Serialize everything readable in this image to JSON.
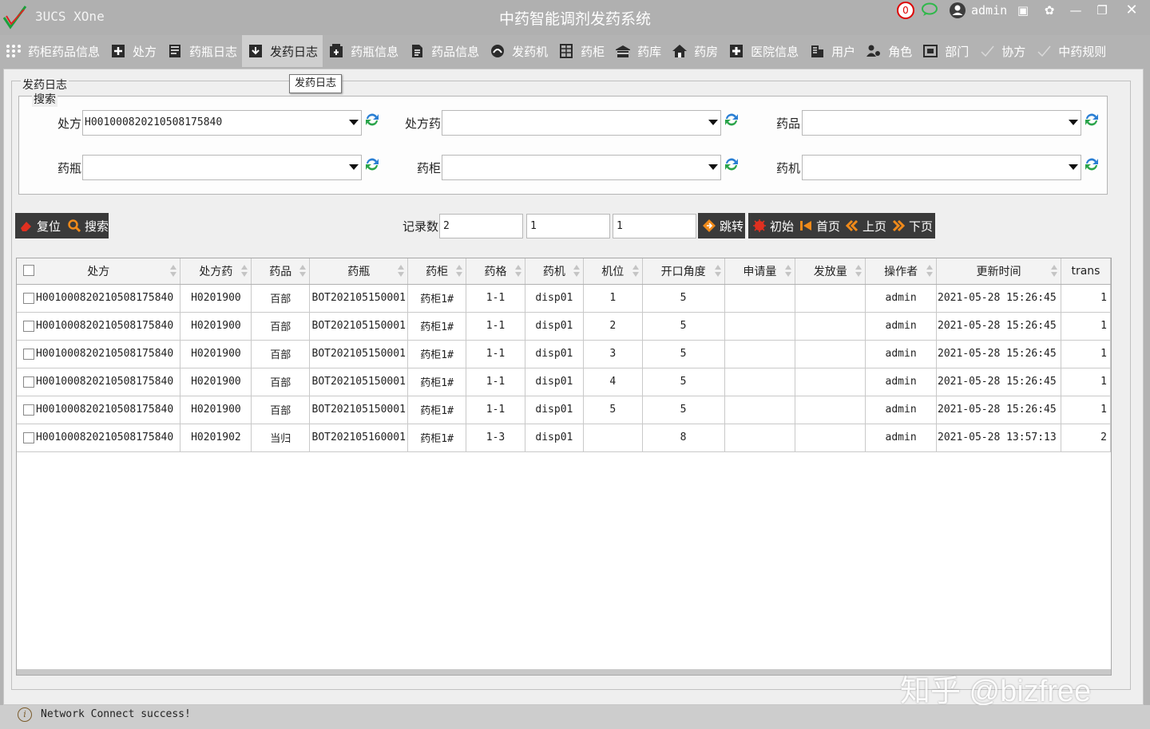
{
  "app": {
    "name": "3UCS XOne",
    "window_title": "中药智能调剂发药系统",
    "notification_count": "0",
    "user_name": "admin"
  },
  "menu": [
    {
      "label": "药柜药品信息",
      "icon": "grid-dots-icon"
    },
    {
      "label": "处方",
      "icon": "prescription-add-icon"
    },
    {
      "label": "药瓶日志",
      "icon": "log-icon"
    },
    {
      "label": "发药日志",
      "icon": "dispense-log-icon",
      "active": true
    },
    {
      "label": "药瓶信息",
      "icon": "bottle-info-icon"
    },
    {
      "label": "药品信息",
      "icon": "drug-doc-icon"
    },
    {
      "label": "发药机",
      "icon": "machine-icon"
    },
    {
      "label": "药柜",
      "icon": "cabinet-icon"
    },
    {
      "label": "药库",
      "icon": "warehouse-icon"
    },
    {
      "label": "药房",
      "icon": "home-icon"
    },
    {
      "label": "医院信息",
      "icon": "hospital-icon"
    },
    {
      "label": "用户",
      "icon": "building-icon"
    },
    {
      "label": "角色",
      "icon": "roles-icon"
    },
    {
      "label": "部门",
      "icon": "department-icon"
    },
    {
      "label": "协方",
      "icon": "check-icon"
    },
    {
      "label": "中药规则",
      "icon": "check-icon"
    }
  ],
  "panel": {
    "title": "发药日志",
    "tooltip": "发药日志",
    "search_title": "搜索"
  },
  "search": {
    "prescription": {
      "label": "处方",
      "value": "H0010008202105081758​40"
    },
    "prescription_drug": {
      "label": "处方药",
      "value": ""
    },
    "drug": {
      "label": "药品",
      "value": ""
    },
    "bottle": {
      "label": "药瓶",
      "value": ""
    },
    "cabinet": {
      "label": "药柜",
      "value": ""
    },
    "machine": {
      "label": "药机",
      "value": ""
    }
  },
  "toolbar": {
    "reset": "复位",
    "search": "搜索",
    "record_count_label": "记录数",
    "record_count": "2",
    "page_current": "1",
    "page_total": "1",
    "jump": "跳转",
    "init": "初始",
    "first": "首页",
    "prev": "上页",
    "next": "下页"
  },
  "table": {
    "columns": [
      "处方",
      "处方药",
      "药品",
      "药瓶",
      "药柜",
      "药格",
      "药机",
      "机位",
      "开口角度",
      "申请量",
      "发放量",
      "操作者",
      "更新时间",
      "trans"
    ],
    "rows": [
      [
        "H00100082021050817584​0",
        "H0201900",
        "百部",
        "BOT202105150001",
        "药柜1#",
        "1-1",
        "disp01",
        "1",
        "5",
        "",
        "",
        "admin",
        "2021-05-28 15:26:45",
        "1"
      ],
      [
        "H00100082021050817584​0",
        "H0201900",
        "百部",
        "BOT202105150001",
        "药柜1#",
        "1-1",
        "disp01",
        "2",
        "5",
        "",
        "",
        "admin",
        "2021-05-28 15:26:45",
        "1"
      ],
      [
        "H00100082021050817584​0",
        "H0201900",
        "百部",
        "BOT202105150001",
        "药柜1#",
        "1-1",
        "disp01",
        "3",
        "5",
        "",
        "",
        "admin",
        "2021-05-28 15:26:45",
        "1"
      ],
      [
        "H00100082021050817584​0",
        "H0201900",
        "百部",
        "BOT202105150001",
        "药柜1#",
        "1-1",
        "disp01",
        "4",
        "5",
        "",
        "",
        "admin",
        "2021-05-28 15:26:45",
        "1"
      ],
      [
        "H00100082021050817584​0",
        "H0201900",
        "百部",
        "BOT202105150001",
        "药柜1#",
        "1-1",
        "disp01",
        "5",
        "5",
        "",
        "",
        "admin",
        "2021-05-28 15:26:45",
        "1"
      ],
      [
        "H00100082021050817584​0",
        "H0201902",
        "当归",
        "BOT202105160001",
        "药柜1#",
        "1-3",
        "disp01",
        "",
        "8",
        "",
        "",
        "admin",
        "2021-05-28 13:57:13",
        "2"
      ]
    ]
  },
  "status": {
    "message": "Network Connect success!"
  },
  "watermark": "知乎 @bizfree",
  "colors": {
    "titlebar": "#b0b0b0",
    "dark_button": "#3a3a3a",
    "refresh_green": "#2aa44a",
    "refresh_blue": "#2a7fd4",
    "accent_red": "#e03020",
    "accent_orange": "#f08a1a"
  }
}
